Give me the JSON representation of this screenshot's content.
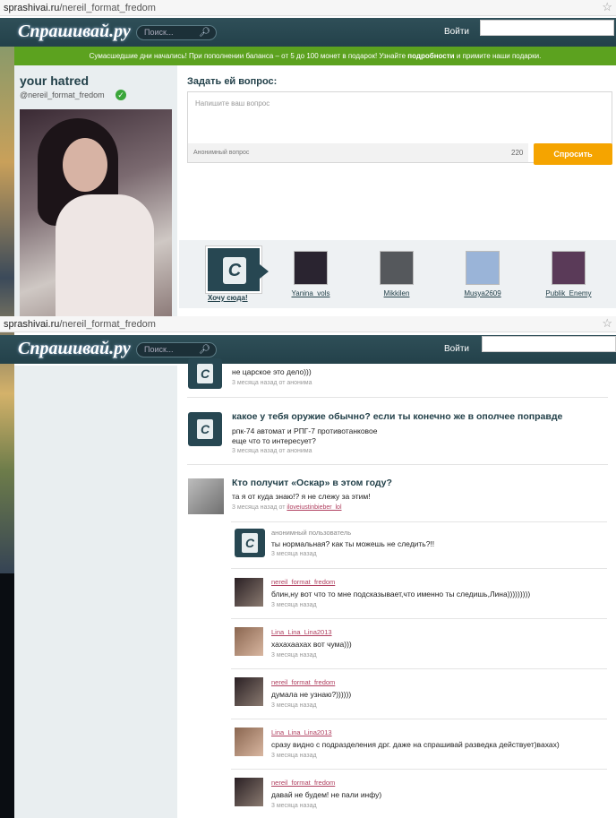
{
  "browser": {
    "url_domain": "sprashivai.ru",
    "url_path": "/nereil_format_fredom",
    "star": "☆"
  },
  "header": {
    "logo": "Спрашивай.ру",
    "search_placeholder": "Поиск...",
    "login_label": "Войти"
  },
  "promo": {
    "text_before": "Сумасшедшие дни начались! При пополнении баланса – от 5 до 100 монет в подарок! Узнайте",
    "link": "подробности",
    "text_after": "и примите наши подарки."
  },
  "profile": {
    "name": "your hatred",
    "handle": "@nereil_format_fredom",
    "verified_icon": "check-icon"
  },
  "ask": {
    "title": "Задать ей вопрос:",
    "placeholder": "Напишите ваш вопрос",
    "anonymous_label": "Анонимный вопрос",
    "char_count": "220",
    "button_label": "Спросить"
  },
  "carousel": {
    "want_label": "Хочу сюда!",
    "users": [
      {
        "name": "Yanina_vols",
        "color": "#2a2430"
      },
      {
        "name": "Mikkilen",
        "color": "#55585c"
      },
      {
        "name": "Musya2609",
        "color": "#9ab4d8"
      },
      {
        "name": "Publik_Enemy",
        "color": "#5a3a58"
      }
    ]
  },
  "feed": {
    "items": [
      {
        "title": "",
        "answer": "не царское это дело)))",
        "meta": "3 месяца назад от анонима"
      },
      {
        "title": "какое у тебя оружие обычно? если ты конечно же в ополчее поправде",
        "answer_line1": "рпк-74 автомат и РПГ-7 противотанковое",
        "answer_line2": "еще что то интересует?",
        "meta": "3 месяца назад от анонима"
      },
      {
        "title": "Кто получит «Оскар» в этом году?",
        "answer": "та я от куда знаю!? я не слежу за этим!",
        "meta_prefix": "3 месяца назад от",
        "meta_link": "iloveiustinbieber_lol"
      }
    ],
    "replies": [
      {
        "author": "анонимный пользователь",
        "text": "ты нормальная? как ты можешь не следить?!!",
        "time": "3 месяца назад"
      },
      {
        "author": "nereil_format_fredom",
        "text": "блин,ну вот что то мне подсказывает,что именно ты следишь,Лина)))))))))",
        "time": "3 месяца назад"
      },
      {
        "author": "Lina_Lina_Lina2013",
        "text": "хахахаахах вот чума)))",
        "time": "3 месяца назад"
      },
      {
        "author": "nereil_format_fredom",
        "text": "думала не узнаю?))))))",
        "time": "3 месяца назад"
      },
      {
        "author": "Lina_Lina_Lina2013",
        "text": "сразу видно с подразделения дрг. даже на спрашивай разведка действует)вахах)",
        "time": "3 месяца назад"
      },
      {
        "author": "nereil_format_fredom",
        "text": "давай не будем! не пали инфу)",
        "time": "3 месяца назад"
      }
    ]
  }
}
